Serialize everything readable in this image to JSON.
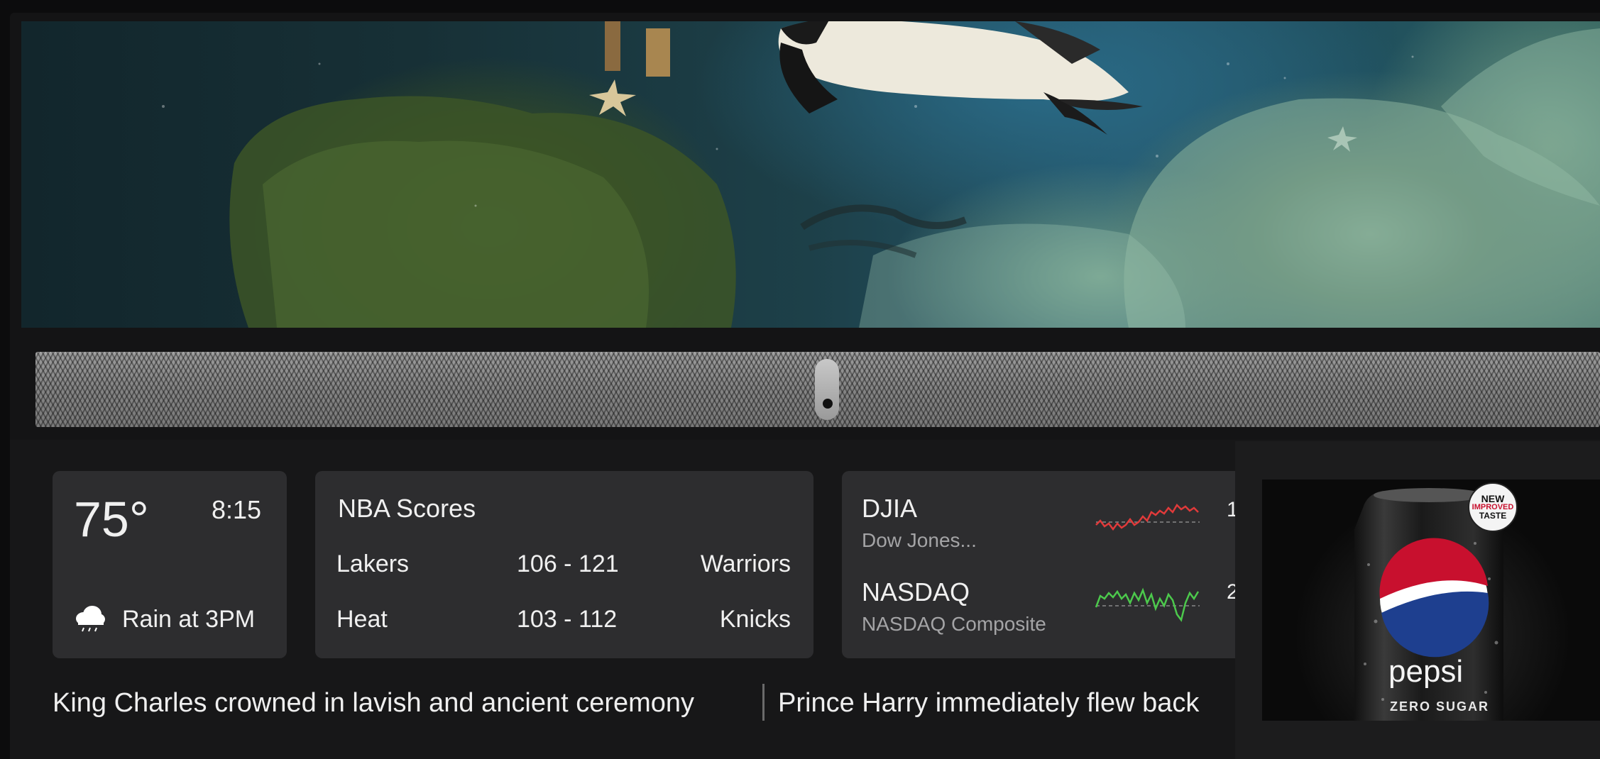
{
  "weather": {
    "temperature": "75°",
    "time": "8:15",
    "forecast": "Rain at 3PM",
    "icon": "rain-cloud-icon"
  },
  "nba": {
    "title": "NBA Scores",
    "games": [
      {
        "home": "Lakers",
        "score": "106 - 121",
        "away": "Warriors"
      },
      {
        "home": "Heat",
        "score": "103 - 112",
        "away": "Knicks"
      }
    ]
  },
  "stocks": [
    {
      "symbol": "DJIA",
      "name": "Dow Jones...",
      "trend_color": "#e03a3a",
      "value_fragment": "1"
    },
    {
      "symbol": "NASDAQ",
      "name": "NASDAQ Composite",
      "trend_color": "#4cc94c",
      "value_fragment": "2"
    }
  ],
  "news": {
    "headline1": "King Charles crowned in lavish and ancient ceremony",
    "headline2": "Prince Harry immediately flew back"
  },
  "ad": {
    "badge": [
      "NEW",
      "IMPROVED",
      "TASTE"
    ],
    "brand": "pepsi",
    "variant": "ZERO SUGAR"
  }
}
